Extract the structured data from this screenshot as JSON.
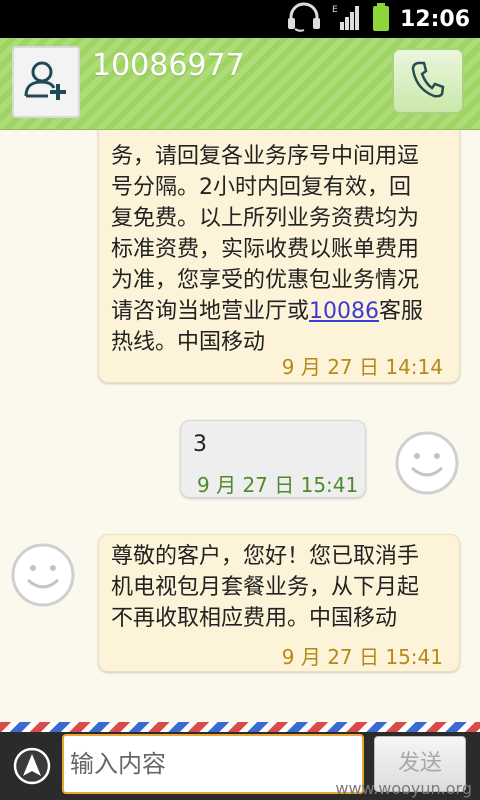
{
  "status_bar": {
    "time": "12:06",
    "icons": [
      "headset-icon",
      "edge-signal-icon",
      "battery-icon"
    ]
  },
  "header": {
    "contact_number": "10086977",
    "add_contact_icon": "add-contact-icon",
    "call_icon": "phone-icon"
  },
  "messages": [
    {
      "direction": "incoming",
      "lines": [
        "务，请回复各业务序号中间用逗",
        "号分隔。2小时内回复有效，回",
        "复免费。以上所列业务资费均为",
        "标准资费，实际收费以账单费用",
        "为准，您享受的优惠包业务情况"
      ],
      "line6_prefix": "请咨询当地营业厅或",
      "line6_link": "10086",
      "line6_suffix": "客服",
      "line7": "热线。中国移动",
      "time": "9 月 27 日 14:14"
    },
    {
      "direction": "outgoing",
      "text": "3",
      "time": "9 月 27 日 15:41"
    },
    {
      "direction": "incoming",
      "lines": [
        "尊敬的客户，您好！您已取消手",
        "机电视包月套餐业务，从下月起",
        "不再收取相应费用。中国移动"
      ],
      "time": "9 月 27 日 15:41"
    }
  ],
  "compose": {
    "placeholder": "输入内容",
    "send_label": "发送"
  },
  "watermark": "www.wooyun.org"
}
